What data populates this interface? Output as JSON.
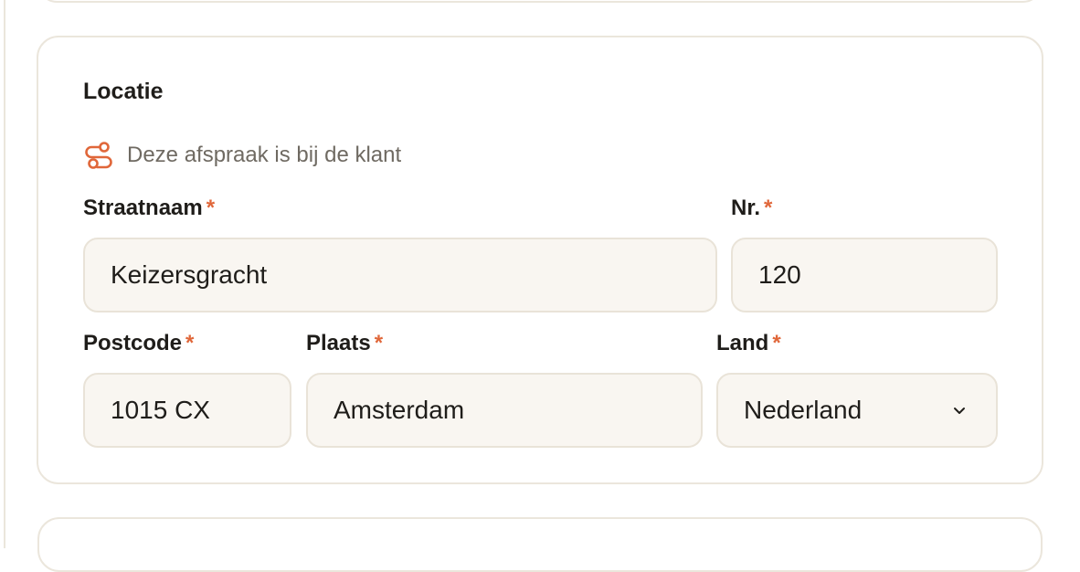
{
  "section": {
    "title": "Locatie",
    "notice": {
      "icon": "route-icon",
      "text": "Deze afspraak is bij de klant"
    }
  },
  "fields": {
    "street": {
      "label": "Straatnaam",
      "required_mark": "*",
      "value": "Keizersgracht"
    },
    "number": {
      "label": "Nr.",
      "required_mark": "*",
      "value": "120"
    },
    "postcode": {
      "label": "Postcode",
      "required_mark": "*",
      "value": "1015 CX"
    },
    "city": {
      "label": "Plaats",
      "required_mark": "*",
      "value": "Amsterdam"
    },
    "country": {
      "label": "Land",
      "required_mark": "*",
      "value": "Nederland",
      "icon": "chevron-down-icon"
    }
  },
  "colors": {
    "accent": "#e0673a",
    "border": "#ebe6dc",
    "field_bg": "#f9f6f1",
    "text": "#1f1d1a",
    "muted_text": "#6f6a62"
  }
}
